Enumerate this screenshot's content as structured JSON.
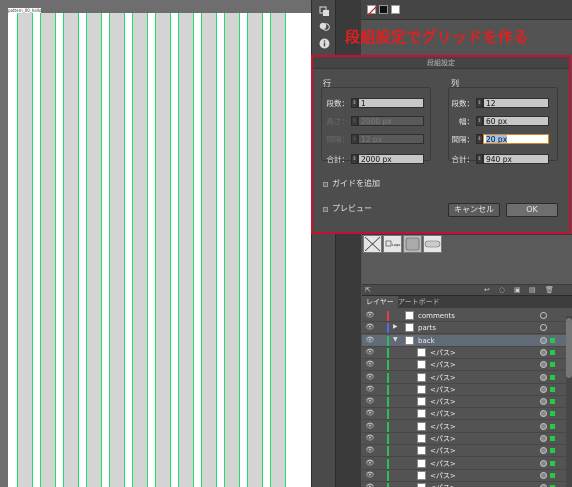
{
  "canvas": {
    "artboard_label": "pattern_00_hello",
    "guide_color": "#22dd66",
    "column_count": 12
  },
  "annotation": {
    "text": "段組設定でグリッドを作る",
    "color": "#e02020"
  },
  "dialog": {
    "title": "段組設定",
    "rows_group": {
      "label": "行",
      "count_label": "段数：",
      "count_value": "1",
      "height_label": "高さ：",
      "height_value": "2000 px",
      "gutter_label": "間隔：",
      "gutter_value": "12 px",
      "total_label": "合計：",
      "total_value": "2000 px"
    },
    "columns_group": {
      "label": "列",
      "count_label": "段数：",
      "count_value": "12",
      "width_label": "幅：",
      "width_value": "60 px",
      "gutter_label": "間隔：",
      "gutter_value": "20 px",
      "total_label": "合計：",
      "total_value": "940 px"
    },
    "add_guides_label": "ガイドを追加",
    "preview_label": "プレビュー",
    "cancel_label": "キャンセル",
    "ok_label": "OK",
    "highlight_color": "#c8102e"
  },
  "panels": {
    "layers_tab": "レイヤー",
    "artboards_tab": "アートボード"
  },
  "layers": [
    {
      "name": "comments",
      "color": "#e04040",
      "expanded": false,
      "has_arrow": false,
      "selected": false,
      "target_filled": false
    },
    {
      "name": "parts",
      "color": "#4a6fe0",
      "expanded": false,
      "has_arrow": true,
      "selected": false,
      "target_filled": false
    },
    {
      "name": "back",
      "color": "#2bbf5a",
      "expanded": true,
      "has_arrow": true,
      "selected": true,
      "target_filled": true
    },
    {
      "name": "<パス>",
      "child": true
    },
    {
      "name": "<パス>",
      "child": true
    },
    {
      "name": "<パス>",
      "child": true
    },
    {
      "name": "<パス>",
      "child": true
    },
    {
      "name": "<パス>",
      "child": true
    },
    {
      "name": "<パス>",
      "child": true
    },
    {
      "name": "<パス>",
      "child": true
    },
    {
      "name": "<パス>",
      "child": true
    },
    {
      "name": "<パス>",
      "child": true
    },
    {
      "name": "<パス>",
      "child": true
    },
    {
      "name": "<パス>",
      "child": true
    },
    {
      "name": "<パス>",
      "child": true
    }
  ],
  "icons": {
    "tool_1": "layers-stack-icon",
    "tool_2": "pathfinder-icon",
    "tool_3": "info-icon",
    "symbols_bottom": [
      "place-symbol-icon",
      "break-link-icon",
      "symbol-options-icon",
      "new-symbol-icon",
      "delete-icon"
    ]
  }
}
